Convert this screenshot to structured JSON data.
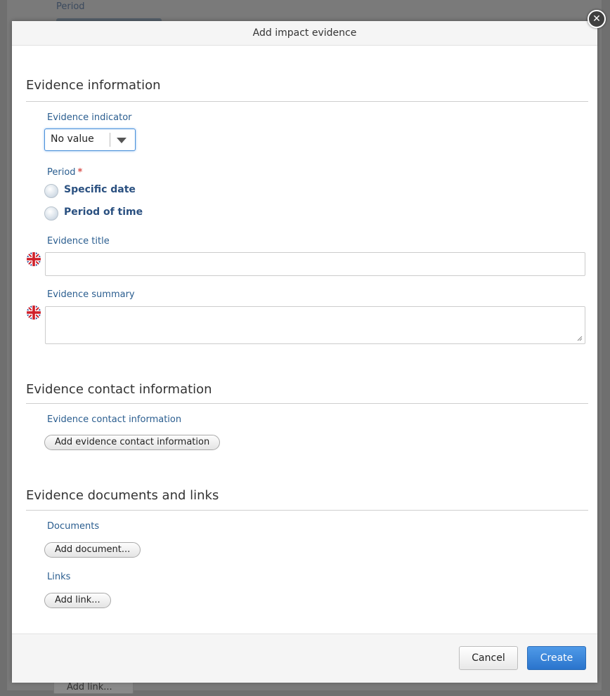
{
  "background": {
    "period_label": "Period",
    "add_link_label": "Add link..."
  },
  "modal": {
    "title": "Add impact evidence",
    "close_icon": "close-icon"
  },
  "evidence_information": {
    "title": "Evidence information",
    "indicator_label": "Evidence indicator",
    "indicator_value": "No value",
    "period_label": "Period",
    "period_required_mark": "*",
    "period_options": [
      "Specific date",
      "Period of time"
    ],
    "title_label": "Evidence title",
    "title_value": "",
    "summary_label": "Evidence summary",
    "summary_value": "",
    "language_icon": "uk-flag-icon"
  },
  "contact_information": {
    "title": "Evidence contact information",
    "label": "Evidence contact information",
    "add_button": "Add evidence contact information"
  },
  "documents_links": {
    "title": "Evidence documents and links",
    "documents_label": "Documents",
    "add_document_button": "Add document...",
    "links_label": "Links",
    "add_link_button": "Add link..."
  },
  "footer": {
    "cancel_label": "Cancel",
    "create_label": "Create"
  },
  "colors": {
    "primary": "#2a74cc",
    "label_blue": "#2a5d8f",
    "required": "#d9534f"
  }
}
